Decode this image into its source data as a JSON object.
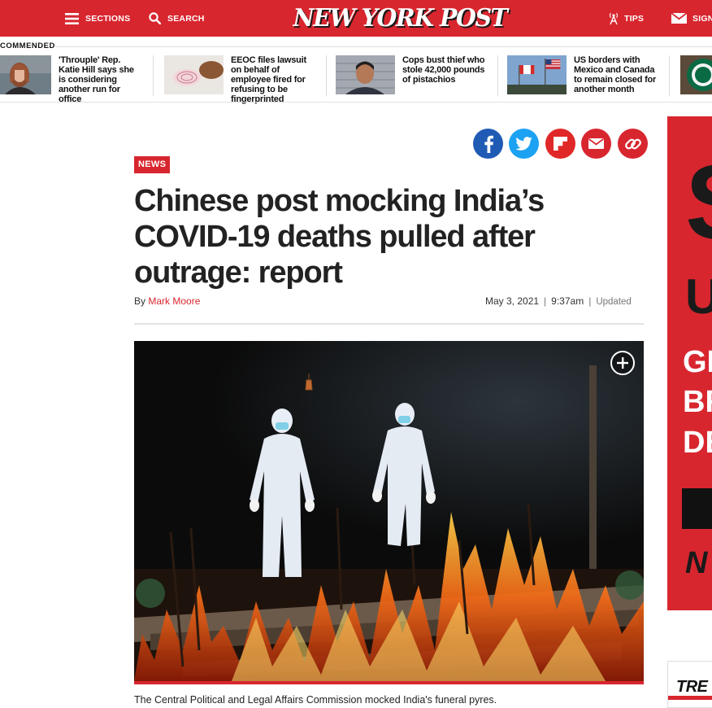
{
  "header": {
    "sections_label": "SECTIONS",
    "search_label": "SEARCH",
    "logo": "NEW YORK POST",
    "tips_label": "TIPS",
    "sign_label": "SIGN"
  },
  "recommended": {
    "label": "COMMENDED",
    "items": [
      {
        "title": "'Throuple' Rep. Katie Hill says she is considering another run for office"
      },
      {
        "title": "EEOC files lawsuit on behalf of employee fired for refusing to be fingerprinted"
      },
      {
        "title": "Cops bust thief who stole 42,000 pounds of pistachios"
      },
      {
        "title": "US borders with Mexico and Canada to remain closed for another month"
      }
    ]
  },
  "share": {
    "icons": [
      "facebook-icon",
      "twitter-icon",
      "flipboard-icon",
      "email-icon",
      "link-icon"
    ],
    "colors": {
      "facebook": "#1f5bb5",
      "twitter": "#1da1f2",
      "flipboard": "#e12828",
      "email": "#d8262f",
      "link": "#d8262f"
    }
  },
  "article": {
    "tag": "NEWS",
    "headline": "Chinese post mocking India’s COVID-19 deaths pulled after outrage: report",
    "byline_prefix": "By",
    "author": "Mark Moore",
    "date": "May 3, 2021",
    "time": "9:37am",
    "updated": "Updated",
    "caption": "The Central Political and Legal Affairs Commission mocked India's funeral pyres."
  },
  "ad": {
    "lines": [
      "S",
      "U",
      "GE",
      "BR",
      "DE",
      "N"
    ],
    "trending": "TRE"
  },
  "colors": {
    "brand_red": "#d8262f",
    "text": "#222222"
  }
}
